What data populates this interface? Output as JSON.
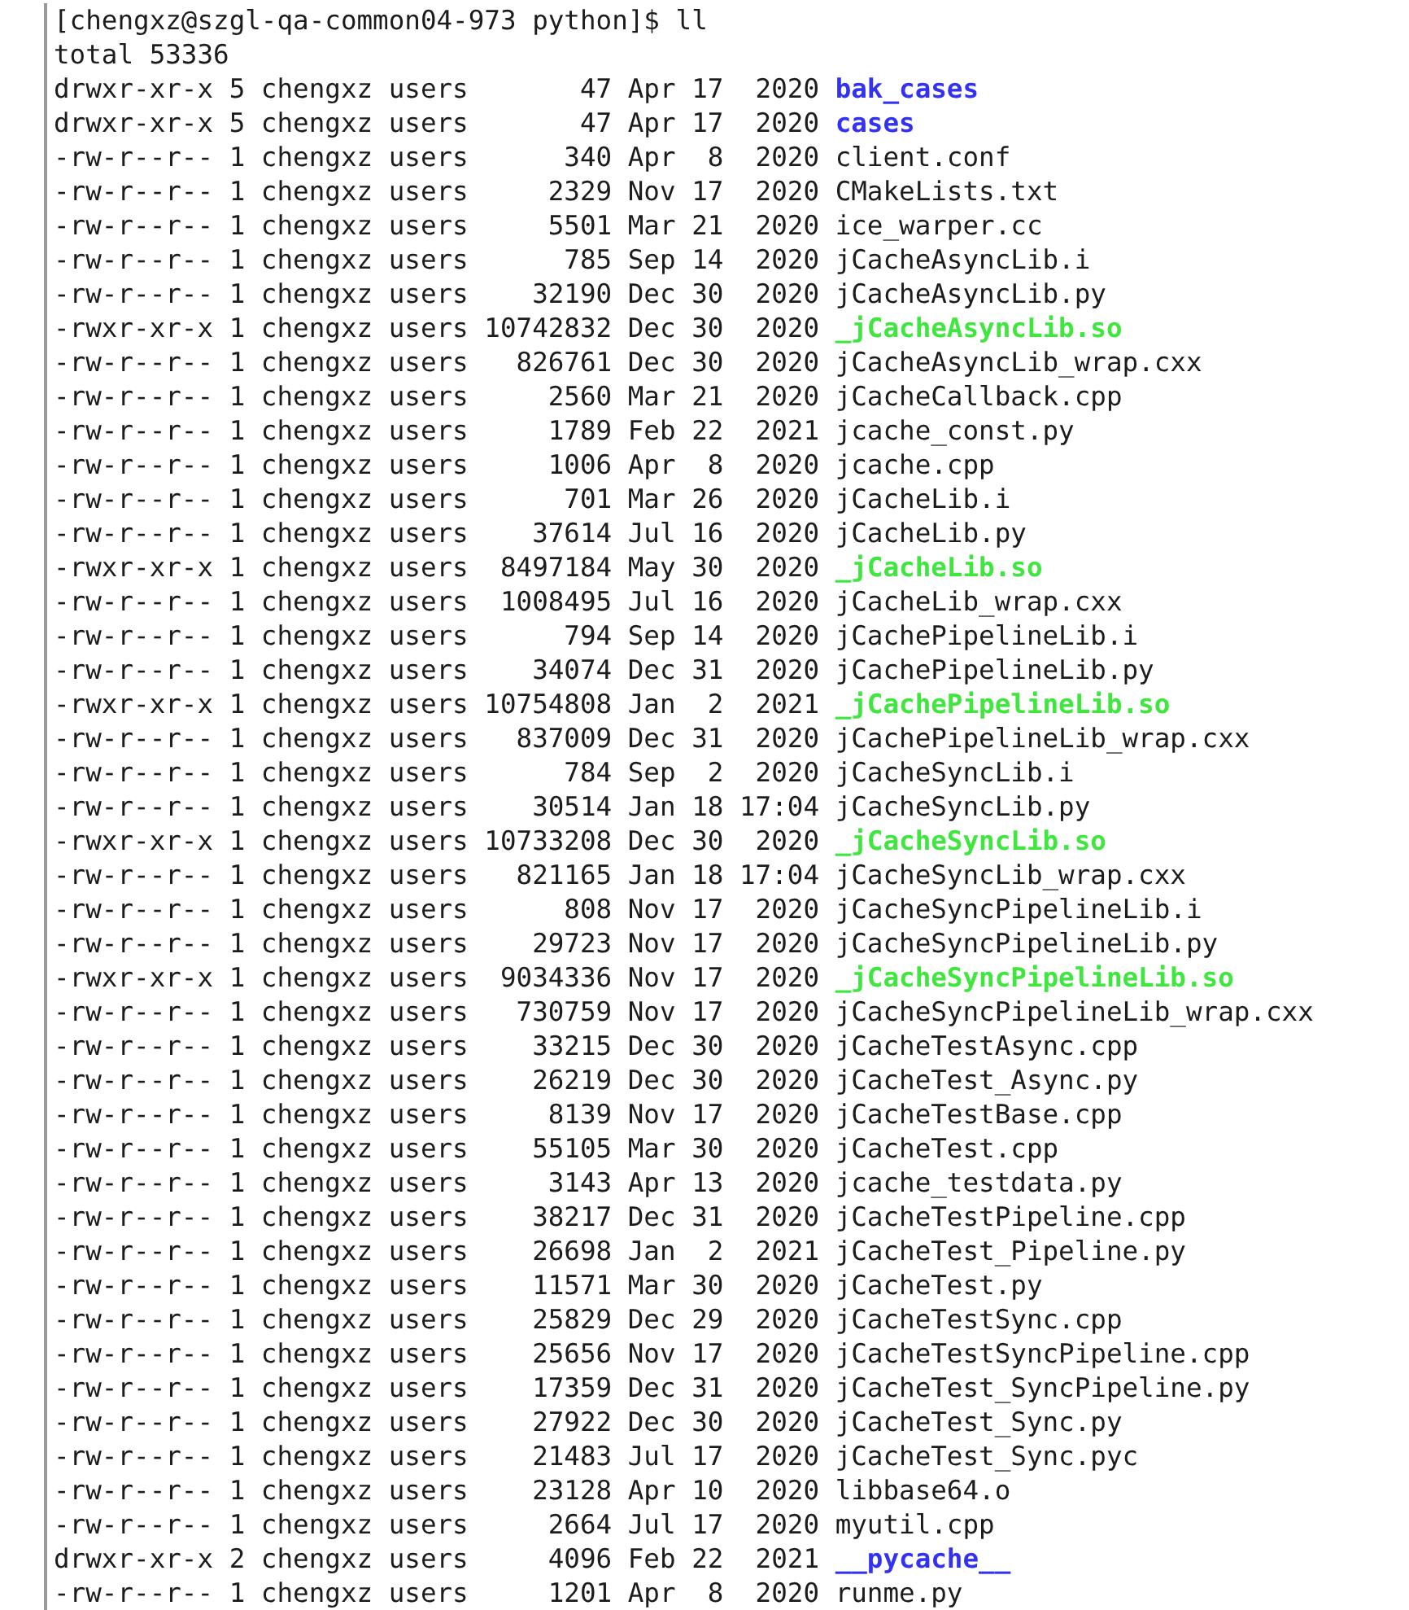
{
  "prompt": "[chengxz@szgl-qa-common04-973 python]$ ll",
  "total": "total 53336",
  "entries": [
    {
      "perms": "drwxr-xr-x",
      "links": "5",
      "owner": "chengxz",
      "group": "users",
      "size": "47",
      "month": "Apr",
      "day": "17",
      "time": "2020",
      "name": "bak_cases",
      "kind": "dir"
    },
    {
      "perms": "drwxr-xr-x",
      "links": "5",
      "owner": "chengxz",
      "group": "users",
      "size": "47",
      "month": "Apr",
      "day": "17",
      "time": "2020",
      "name": "cases",
      "kind": "dir"
    },
    {
      "perms": "-rw-r--r--",
      "links": "1",
      "owner": "chengxz",
      "group": "users",
      "size": "340",
      "month": "Apr",
      "day": "8",
      "time": "2020",
      "name": "client.conf",
      "kind": "file"
    },
    {
      "perms": "-rw-r--r--",
      "links": "1",
      "owner": "chengxz",
      "group": "users",
      "size": "2329",
      "month": "Nov",
      "day": "17",
      "time": "2020",
      "name": "CMakeLists.txt",
      "kind": "file"
    },
    {
      "perms": "-rw-r--r--",
      "links": "1",
      "owner": "chengxz",
      "group": "users",
      "size": "5501",
      "month": "Mar",
      "day": "21",
      "time": "2020",
      "name": "ice_warper.cc",
      "kind": "file"
    },
    {
      "perms": "-rw-r--r--",
      "links": "1",
      "owner": "chengxz",
      "group": "users",
      "size": "785",
      "month": "Sep",
      "day": "14",
      "time": "2020",
      "name": "jCacheAsyncLib.i",
      "kind": "file"
    },
    {
      "perms": "-rw-r--r--",
      "links": "1",
      "owner": "chengxz",
      "group": "users",
      "size": "32190",
      "month": "Dec",
      "day": "30",
      "time": "2020",
      "name": "jCacheAsyncLib.py",
      "kind": "file"
    },
    {
      "perms": "-rwxr-xr-x",
      "links": "1",
      "owner": "chengxz",
      "group": "users",
      "size": "10742832",
      "month": "Dec",
      "day": "30",
      "time": "2020",
      "name": "_jCacheAsyncLib.so",
      "kind": "exec"
    },
    {
      "perms": "-rw-r--r--",
      "links": "1",
      "owner": "chengxz",
      "group": "users",
      "size": "826761",
      "month": "Dec",
      "day": "30",
      "time": "2020",
      "name": "jCacheAsyncLib_wrap.cxx",
      "kind": "file"
    },
    {
      "perms": "-rw-r--r--",
      "links": "1",
      "owner": "chengxz",
      "group": "users",
      "size": "2560",
      "month": "Mar",
      "day": "21",
      "time": "2020",
      "name": "jCacheCallback.cpp",
      "kind": "file"
    },
    {
      "perms": "-rw-r--r--",
      "links": "1",
      "owner": "chengxz",
      "group": "users",
      "size": "1789",
      "month": "Feb",
      "day": "22",
      "time": "2021",
      "name": "jcache_const.py",
      "kind": "file"
    },
    {
      "perms": "-rw-r--r--",
      "links": "1",
      "owner": "chengxz",
      "group": "users",
      "size": "1006",
      "month": "Apr",
      "day": "8",
      "time": "2020",
      "name": "jcache.cpp",
      "kind": "file"
    },
    {
      "perms": "-rw-r--r--",
      "links": "1",
      "owner": "chengxz",
      "group": "users",
      "size": "701",
      "month": "Mar",
      "day": "26",
      "time": "2020",
      "name": "jCacheLib.i",
      "kind": "file"
    },
    {
      "perms": "-rw-r--r--",
      "links": "1",
      "owner": "chengxz",
      "group": "users",
      "size": "37614",
      "month": "Jul",
      "day": "16",
      "time": "2020",
      "name": "jCacheLib.py",
      "kind": "file"
    },
    {
      "perms": "-rwxr-xr-x",
      "links": "1",
      "owner": "chengxz",
      "group": "users",
      "size": "8497184",
      "month": "May",
      "day": "30",
      "time": "2020",
      "name": "_jCacheLib.so",
      "kind": "exec"
    },
    {
      "perms": "-rw-r--r--",
      "links": "1",
      "owner": "chengxz",
      "group": "users",
      "size": "1008495",
      "month": "Jul",
      "day": "16",
      "time": "2020",
      "name": "jCacheLib_wrap.cxx",
      "kind": "file"
    },
    {
      "perms": "-rw-r--r--",
      "links": "1",
      "owner": "chengxz",
      "group": "users",
      "size": "794",
      "month": "Sep",
      "day": "14",
      "time": "2020",
      "name": "jCachePipelineLib.i",
      "kind": "file"
    },
    {
      "perms": "-rw-r--r--",
      "links": "1",
      "owner": "chengxz",
      "group": "users",
      "size": "34074",
      "month": "Dec",
      "day": "31",
      "time": "2020",
      "name": "jCachePipelineLib.py",
      "kind": "file"
    },
    {
      "perms": "-rwxr-xr-x",
      "links": "1",
      "owner": "chengxz",
      "group": "users",
      "size": "10754808",
      "month": "Jan",
      "day": "2",
      "time": "2021",
      "name": "_jCachePipelineLib.so",
      "kind": "exec"
    },
    {
      "perms": "-rw-r--r--",
      "links": "1",
      "owner": "chengxz",
      "group": "users",
      "size": "837009",
      "month": "Dec",
      "day": "31",
      "time": "2020",
      "name": "jCachePipelineLib_wrap.cxx",
      "kind": "file"
    },
    {
      "perms": "-rw-r--r--",
      "links": "1",
      "owner": "chengxz",
      "group": "users",
      "size": "784",
      "month": "Sep",
      "day": "2",
      "time": "2020",
      "name": "jCacheSyncLib.i",
      "kind": "file"
    },
    {
      "perms": "-rw-r--r--",
      "links": "1",
      "owner": "chengxz",
      "group": "users",
      "size": "30514",
      "month": "Jan",
      "day": "18",
      "time": "17:04",
      "name": "jCacheSyncLib.py",
      "kind": "file"
    },
    {
      "perms": "-rwxr-xr-x",
      "links": "1",
      "owner": "chengxz",
      "group": "users",
      "size": "10733208",
      "month": "Dec",
      "day": "30",
      "time": "2020",
      "name": "_jCacheSyncLib.so",
      "kind": "exec"
    },
    {
      "perms": "-rw-r--r--",
      "links": "1",
      "owner": "chengxz",
      "group": "users",
      "size": "821165",
      "month": "Jan",
      "day": "18",
      "time": "17:04",
      "name": "jCacheSyncLib_wrap.cxx",
      "kind": "file"
    },
    {
      "perms": "-rw-r--r--",
      "links": "1",
      "owner": "chengxz",
      "group": "users",
      "size": "808",
      "month": "Nov",
      "day": "17",
      "time": "2020",
      "name": "jCacheSyncPipelineLib.i",
      "kind": "file"
    },
    {
      "perms": "-rw-r--r--",
      "links": "1",
      "owner": "chengxz",
      "group": "users",
      "size": "29723",
      "month": "Nov",
      "day": "17",
      "time": "2020",
      "name": "jCacheSyncPipelineLib.py",
      "kind": "file"
    },
    {
      "perms": "-rwxr-xr-x",
      "links": "1",
      "owner": "chengxz",
      "group": "users",
      "size": "9034336",
      "month": "Nov",
      "day": "17",
      "time": "2020",
      "name": "_jCacheSyncPipelineLib.so",
      "kind": "exec"
    },
    {
      "perms": "-rw-r--r--",
      "links": "1",
      "owner": "chengxz",
      "group": "users",
      "size": "730759",
      "month": "Nov",
      "day": "17",
      "time": "2020",
      "name": "jCacheSyncPipelineLib_wrap.cxx",
      "kind": "file"
    },
    {
      "perms": "-rw-r--r--",
      "links": "1",
      "owner": "chengxz",
      "group": "users",
      "size": "33215",
      "month": "Dec",
      "day": "30",
      "time": "2020",
      "name": "jCacheTestAsync.cpp",
      "kind": "file"
    },
    {
      "perms": "-rw-r--r--",
      "links": "1",
      "owner": "chengxz",
      "group": "users",
      "size": "26219",
      "month": "Dec",
      "day": "30",
      "time": "2020",
      "name": "jCacheTest_Async.py",
      "kind": "file"
    },
    {
      "perms": "-rw-r--r--",
      "links": "1",
      "owner": "chengxz",
      "group": "users",
      "size": "8139",
      "month": "Nov",
      "day": "17",
      "time": "2020",
      "name": "jCacheTestBase.cpp",
      "kind": "file"
    },
    {
      "perms": "-rw-r--r--",
      "links": "1",
      "owner": "chengxz",
      "group": "users",
      "size": "55105",
      "month": "Mar",
      "day": "30",
      "time": "2020",
      "name": "jCacheTest.cpp",
      "kind": "file"
    },
    {
      "perms": "-rw-r--r--",
      "links": "1",
      "owner": "chengxz",
      "group": "users",
      "size": "3143",
      "month": "Apr",
      "day": "13",
      "time": "2020",
      "name": "jcache_testdata.py",
      "kind": "file"
    },
    {
      "perms": "-rw-r--r--",
      "links": "1",
      "owner": "chengxz",
      "group": "users",
      "size": "38217",
      "month": "Dec",
      "day": "31",
      "time": "2020",
      "name": "jCacheTestPipeline.cpp",
      "kind": "file"
    },
    {
      "perms": "-rw-r--r--",
      "links": "1",
      "owner": "chengxz",
      "group": "users",
      "size": "26698",
      "month": "Jan",
      "day": "2",
      "time": "2021",
      "name": "jCacheTest_Pipeline.py",
      "kind": "file"
    },
    {
      "perms": "-rw-r--r--",
      "links": "1",
      "owner": "chengxz",
      "group": "users",
      "size": "11571",
      "month": "Mar",
      "day": "30",
      "time": "2020",
      "name": "jCacheTest.py",
      "kind": "file"
    },
    {
      "perms": "-rw-r--r--",
      "links": "1",
      "owner": "chengxz",
      "group": "users",
      "size": "25829",
      "month": "Dec",
      "day": "29",
      "time": "2020",
      "name": "jCacheTestSync.cpp",
      "kind": "file"
    },
    {
      "perms": "-rw-r--r--",
      "links": "1",
      "owner": "chengxz",
      "group": "users",
      "size": "25656",
      "month": "Nov",
      "day": "17",
      "time": "2020",
      "name": "jCacheTestSyncPipeline.cpp",
      "kind": "file"
    },
    {
      "perms": "-rw-r--r--",
      "links": "1",
      "owner": "chengxz",
      "group": "users",
      "size": "17359",
      "month": "Dec",
      "day": "31",
      "time": "2020",
      "name": "jCacheTest_SyncPipeline.py",
      "kind": "file"
    },
    {
      "perms": "-rw-r--r--",
      "links": "1",
      "owner": "chengxz",
      "group": "users",
      "size": "27922",
      "month": "Dec",
      "day": "30",
      "time": "2020",
      "name": "jCacheTest_Sync.py",
      "kind": "file"
    },
    {
      "perms": "-rw-r--r--",
      "links": "1",
      "owner": "chengxz",
      "group": "users",
      "size": "21483",
      "month": "Jul",
      "day": "17",
      "time": "2020",
      "name": "jCacheTest_Sync.pyc",
      "kind": "file"
    },
    {
      "perms": "-rw-r--r--",
      "links": "1",
      "owner": "chengxz",
      "group": "users",
      "size": "23128",
      "month": "Apr",
      "day": "10",
      "time": "2020",
      "name": "libbase64.o",
      "kind": "file"
    },
    {
      "perms": "-rw-r--r--",
      "links": "1",
      "owner": "chengxz",
      "group": "users",
      "size": "2664",
      "month": "Jul",
      "day": "17",
      "time": "2020",
      "name": "myutil.cpp",
      "kind": "file"
    },
    {
      "perms": "drwxr-xr-x",
      "links": "2",
      "owner": "chengxz",
      "group": "users",
      "size": "4096",
      "month": "Feb",
      "day": "22",
      "time": "2021",
      "name": "__pycache__",
      "kind": "dir"
    },
    {
      "perms": "-rw-r--r--",
      "links": "1",
      "owner": "chengxz",
      "group": "users",
      "size": "1201",
      "month": "Apr",
      "day": "8",
      "time": "2020",
      "name": "runme.py",
      "kind": "file"
    }
  ]
}
